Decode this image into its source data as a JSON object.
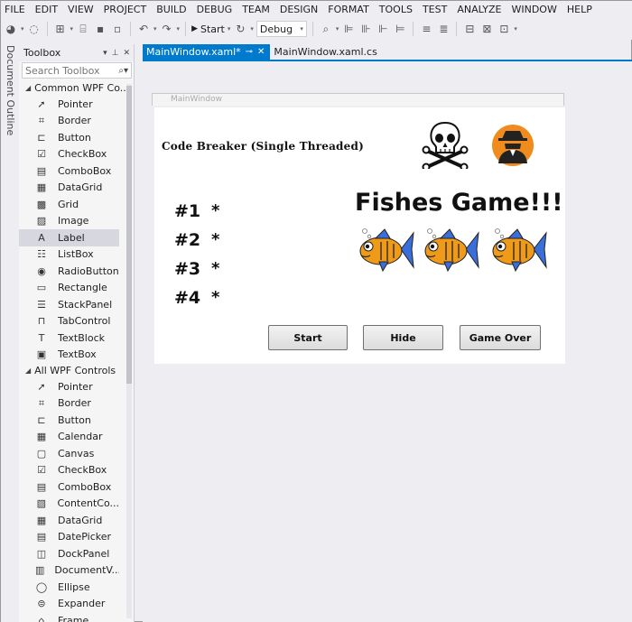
{
  "menu": [
    "FILE",
    "EDIT",
    "VIEW",
    "PROJECT",
    "BUILD",
    "DEBUG",
    "TEAM",
    "DESIGN",
    "FORMAT",
    "TOOLS",
    "TEST",
    "ANALYZE",
    "WINDOW",
    "HELP"
  ],
  "toolbar": {
    "start_label": "Start",
    "config_value": "Debug"
  },
  "side_tab": {
    "label": "Document Outline"
  },
  "toolbox": {
    "title": "Toolbox",
    "search_placeholder": "Search Toolbox",
    "groups": [
      {
        "label": "Common WPF Co...",
        "items": [
          {
            "label": "Pointer",
            "icon": "pointer-icon",
            "glyph": "➚"
          },
          {
            "label": "Border",
            "icon": "border-icon",
            "glyph": "⌗"
          },
          {
            "label": "Button",
            "icon": "button-icon",
            "glyph": "⊏"
          },
          {
            "label": "CheckBox",
            "icon": "checkbox-icon",
            "glyph": "☑"
          },
          {
            "label": "ComboBox",
            "icon": "combobox-icon",
            "glyph": "▤"
          },
          {
            "label": "DataGrid",
            "icon": "datagrid-icon",
            "glyph": "▦"
          },
          {
            "label": "Grid",
            "icon": "grid-icon",
            "glyph": "▩"
          },
          {
            "label": "Image",
            "icon": "image-icon",
            "glyph": "▨"
          },
          {
            "label": "Label",
            "icon": "label-icon",
            "glyph": "A",
            "selected": true
          },
          {
            "label": "ListBox",
            "icon": "listbox-icon",
            "glyph": "☷"
          },
          {
            "label": "RadioButton",
            "icon": "radiobutton-icon",
            "glyph": "◉"
          },
          {
            "label": "Rectangle",
            "icon": "rectangle-icon",
            "glyph": "▭"
          },
          {
            "label": "StackPanel",
            "icon": "stackpanel-icon",
            "glyph": "☰"
          },
          {
            "label": "TabControl",
            "icon": "tabcontrol-icon",
            "glyph": "⊓"
          },
          {
            "label": "TextBlock",
            "icon": "textblock-icon",
            "glyph": "T"
          },
          {
            "label": "TextBox",
            "icon": "textbox-icon",
            "glyph": "▣"
          }
        ]
      },
      {
        "label": "All WPF Controls",
        "items": [
          {
            "label": "Pointer",
            "icon": "pointer-icon",
            "glyph": "➚"
          },
          {
            "label": "Border",
            "icon": "border-icon",
            "glyph": "⌗"
          },
          {
            "label": "Button",
            "icon": "button-icon",
            "glyph": "⊏"
          },
          {
            "label": "Calendar",
            "icon": "calendar-icon",
            "glyph": "▦"
          },
          {
            "label": "Canvas",
            "icon": "canvas-icon",
            "glyph": "▢"
          },
          {
            "label": "CheckBox",
            "icon": "checkbox-icon",
            "glyph": "☑"
          },
          {
            "label": "ComboBox",
            "icon": "combobox-icon",
            "glyph": "▤"
          },
          {
            "label": "ContentCo...",
            "icon": "contentcontrol-icon",
            "glyph": "▧"
          },
          {
            "label": "DataGrid",
            "icon": "datagrid-icon",
            "glyph": "▦"
          },
          {
            "label": "DatePicker",
            "icon": "datepicker-icon",
            "glyph": "▤"
          },
          {
            "label": "DockPanel",
            "icon": "dockpanel-icon",
            "glyph": "◫"
          },
          {
            "label": "DocumentV...",
            "icon": "documentviewer-icon",
            "glyph": "▥"
          },
          {
            "label": "Ellipse",
            "icon": "ellipse-icon",
            "glyph": "◯"
          },
          {
            "label": "Expander",
            "icon": "expander-icon",
            "glyph": "⊜"
          },
          {
            "label": "Frame",
            "icon": "frame-icon",
            "glyph": "⌂"
          }
        ]
      }
    ]
  },
  "tabs": [
    {
      "label": "MainWindow.xaml*",
      "active": true
    },
    {
      "label": "MainWindow.xaml.cs",
      "active": false
    }
  ],
  "designer": {
    "ruler_caption": "MainWindow",
    "window": {
      "title": "Code Breaker (Single Threaded)",
      "rows": [
        {
          "num": "#1",
          "value": "*"
        },
        {
          "num": "#2",
          "value": "*"
        },
        {
          "num": "#3",
          "value": "*"
        },
        {
          "num": "#4",
          "value": "*"
        }
      ],
      "game_title": "Fishes Game!!!",
      "buttons": {
        "start": "Start",
        "hide": "Hide",
        "game_over": "Game Over"
      }
    }
  },
  "colors": {
    "accent": "#007acc",
    "chrome": "#eeeef2",
    "fish_orange": "#f09a1a",
    "fish_fin": "#3a6ed8",
    "spy_orange": "#f08c1e"
  }
}
